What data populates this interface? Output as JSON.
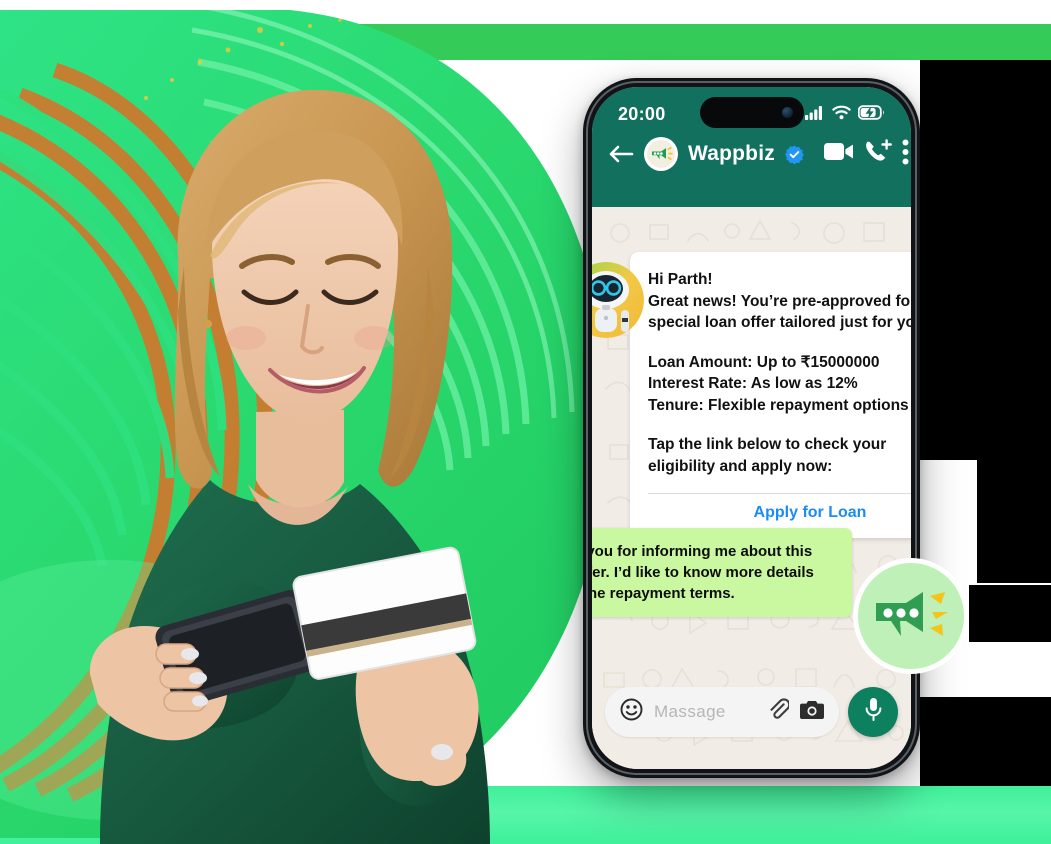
{
  "brand": {
    "accent_green": "#35cb58",
    "swirl_green": "#2fd870",
    "whatsapp_header": "#12705f",
    "bubble_out_green": "#c9f8a0",
    "link_blue": "#1a8cf5",
    "mic_green": "#0d8060",
    "badge_bg": "#bff0b7"
  },
  "phone": {
    "status": {
      "time": "20:00",
      "signal_icon": "cellular-signal-icon",
      "wifi_icon": "wifi-icon",
      "battery_icon": "battery-charging-icon"
    },
    "nav": {
      "back_icon": "back-arrow-icon",
      "avatar_icon": "megaphone-avatar-icon",
      "contact_name": "Wappbiz",
      "verified_icon": "verified-badge-icon",
      "video_icon": "video-call-icon",
      "call_icon": "add-call-icon",
      "menu_icon": "overflow-menu-icon"
    },
    "messages": {
      "incoming": {
        "avatar_icon": "robot-avatar-icon",
        "greeting": "Hi Parth!",
        "line1": "Great news! You’re pre-approved for a",
        "line2": "special loan offer tailored just for you.",
        "detail1": "Loan Amount: Up to ₹15000000",
        "detail2": "Interest Rate: As low as 12%",
        "detail3": "Tenure: Flexible repayment options",
        "closing1": "Tap the link below to check your",
        "closing2": "eligibility and apply now:",
        "cta_label": "Apply for Loan"
      },
      "outgoing": {
        "line1": "Thank you for informing me about this",
        "line2": "loan offer. I’d like to know more details",
        "line3": "about the repayment terms."
      }
    },
    "input_bar": {
      "emoji_icon": "emoji-smiley-icon",
      "placeholder": "Massage",
      "value": "",
      "attach_icon": "paperclip-icon",
      "camera_icon": "camera-icon",
      "mic_icon": "microphone-icon"
    }
  },
  "decoration": {
    "badge_icon": "megaphone-chat-badge-icon",
    "photo_alt": "smiling-woman-with-phone-and-credit-card"
  }
}
